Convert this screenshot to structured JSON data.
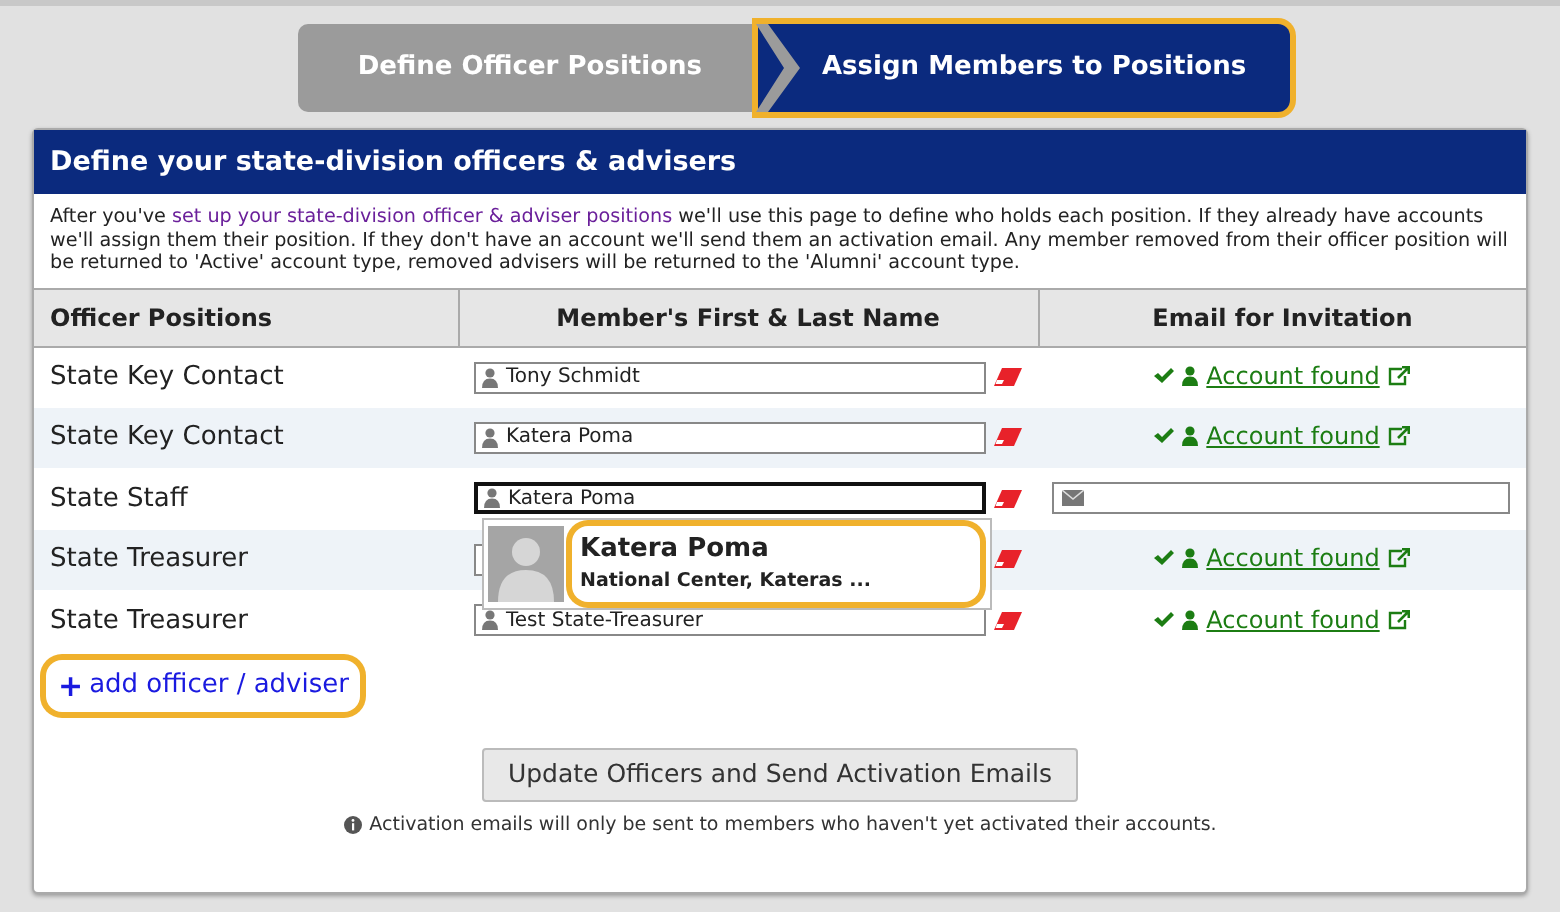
{
  "steps": [
    {
      "label": "Define Officer Positions",
      "selected": false,
      "highlighted": false
    },
    {
      "label": "Assign Members to Positions",
      "selected": true,
      "highlighted": true
    }
  ],
  "panel": {
    "title": "Define your state-division officers & advisers",
    "intro_before": "After you've ",
    "intro_link": "set up your state-division officer & adviser positions",
    "intro_after": " we'll use this page to define who holds each position. If they already have accounts we'll assign them their position. If they don't have an account we'll send them an activation email. Any member removed from their officer position will be returned to 'Active' account type, removed advisers will be returned to the 'Alumni' account type."
  },
  "table": {
    "columns": [
      "Officer Positions",
      "Member's First & Last Name",
      "Email for Invitation"
    ],
    "rows": [
      {
        "position": "State Key Contact",
        "member": "Tony Schmidt",
        "focused": false,
        "kind": "found",
        "status": "Account found"
      },
      {
        "position": "State Key Contact",
        "member": "Katera Poma",
        "focused": false,
        "kind": "found",
        "status": "Account found"
      },
      {
        "position": "State Staff",
        "member": "Katera Poma",
        "focused": true,
        "kind": "email"
      },
      {
        "position": "State Treasurer",
        "focused": false,
        "kind": "found",
        "status": "Account found"
      },
      {
        "position": "State Treasurer",
        "member": "Test State-Treasurer",
        "focused": false,
        "kind": "found",
        "status": "Account found"
      }
    ]
  },
  "suggestion": {
    "name": "Katera Poma",
    "detail": "National Center, Kateras ...",
    "highlighted": true
  },
  "add_link": {
    "label": "add officer / adviser",
    "icon": "+",
    "highlighted": true
  },
  "submit_button": "Update Officers and Send Activation Emails",
  "note": "Activation emails will only be sent to members who haven't yet activated their accounts."
}
